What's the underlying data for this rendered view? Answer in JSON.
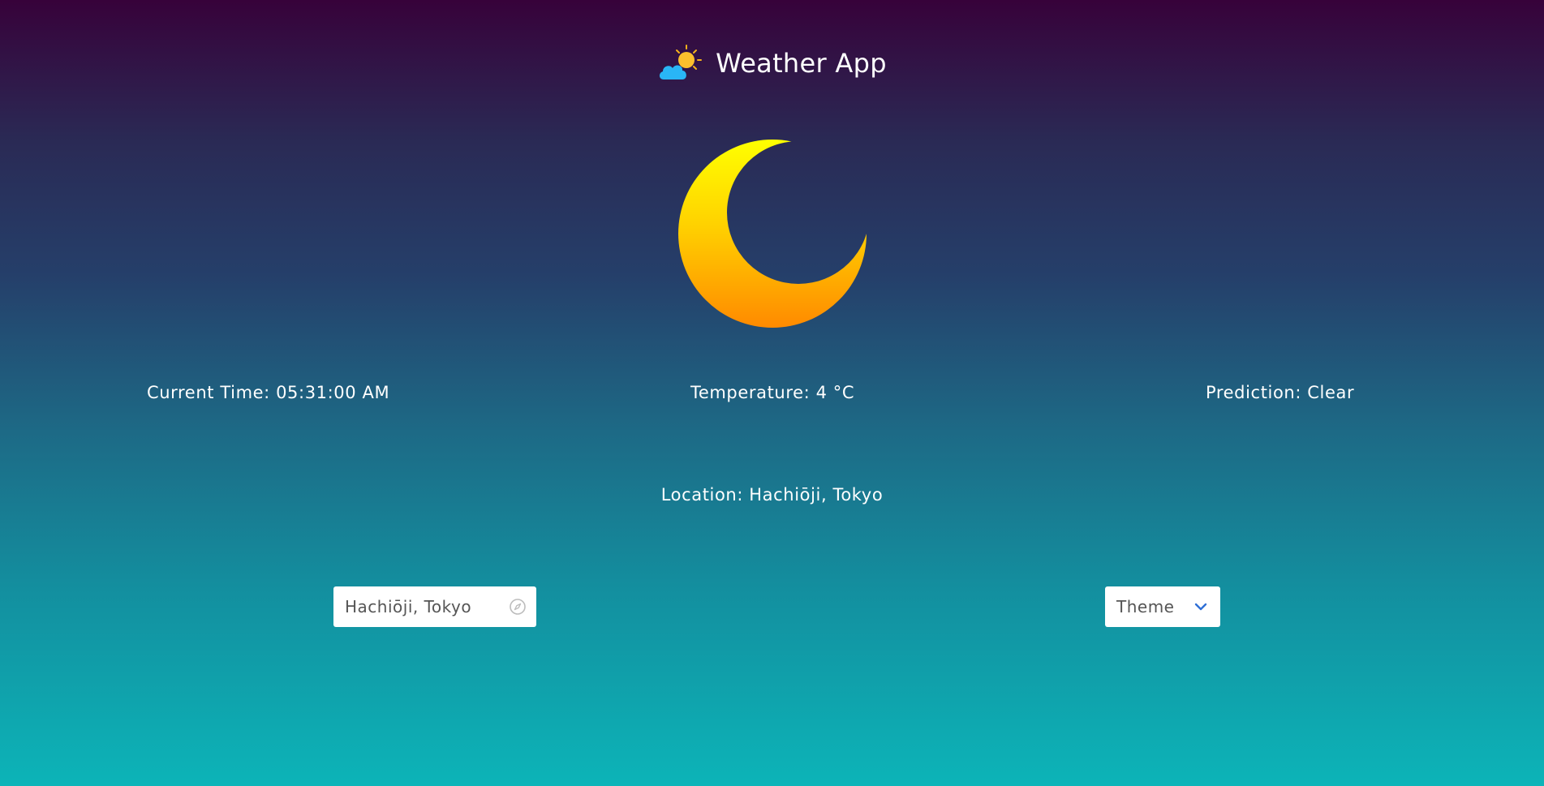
{
  "header": {
    "title": "Weather App",
    "logo_icon": "sun-behind-cloud-icon"
  },
  "weather_icon": "crescent-moon-icon",
  "info": {
    "current_time": "Current Time: 05:31:00 AM",
    "temperature": "Temperature: 4 °C",
    "prediction": "Prediction: Clear",
    "location": "Location: Hachiōji, Tokyo"
  },
  "search": {
    "value": "Hachiōji, Tokyo",
    "icon": "compass-icon"
  },
  "theme_select": {
    "label": "Theme",
    "icon": "chevron-down-icon"
  },
  "colors": {
    "gradient_top": "#37023a",
    "gradient_bottom": "#0cb4b8",
    "moon_top": "#ffff00",
    "moon_bottom": "#ff8a00",
    "chevron": "#2f6fd6"
  }
}
